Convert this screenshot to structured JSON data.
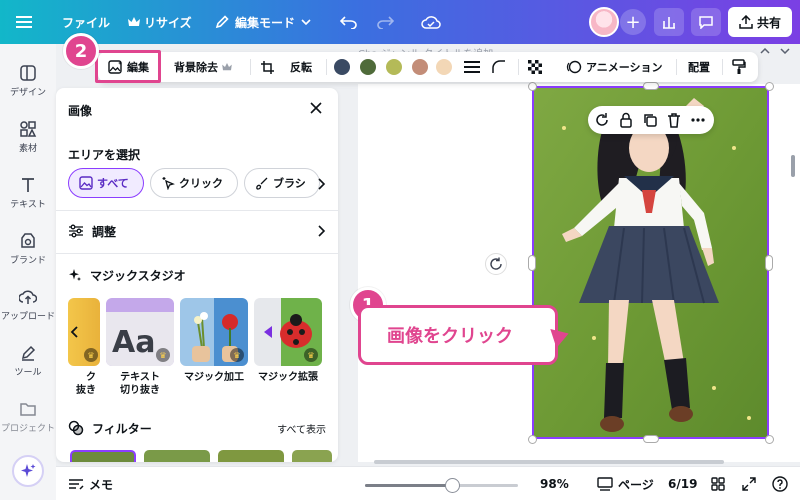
{
  "topbar": {
    "file_label": "ファイル",
    "resize_label": "リサイズ",
    "edit_mode_label": "編集モード",
    "share_label": "共有"
  },
  "ghost_title": "Cha ジャンル タイトルを追加",
  "rail": {
    "items": [
      {
        "label": "デザイン",
        "icon": "layout-icon"
      },
      {
        "label": "素材",
        "icon": "shapes-icon"
      },
      {
        "label": "テキスト",
        "icon": "text-icon"
      },
      {
        "label": "ブランド",
        "icon": "brand-icon"
      },
      {
        "label": "アップロード",
        "icon": "upload-icon"
      },
      {
        "label": "ツール",
        "icon": "pen-icon"
      },
      {
        "label": "プロジェクト",
        "icon": "folder-icon"
      }
    ]
  },
  "toolbar": {
    "edit_label": "編集",
    "bg_remove_label": "背景除去",
    "flip_label": "反転",
    "animation_label": "アニメーション",
    "position_label": "配置",
    "swatches": [
      "#3a4a63",
      "#4f6b3a",
      "#b4ba58",
      "#c38d78",
      "#f3d7b6"
    ]
  },
  "panel": {
    "title": "画像",
    "select_area_label": "エリアを選択",
    "chips": [
      "すべて",
      "クリック",
      "ブラシ"
    ],
    "adjust_label": "調整",
    "magic_studio_label": "マジックスタジオ",
    "tiles": [
      {
        "label": "ク\n抜き"
      },
      {
        "label": "テキスト\n切り抜き"
      },
      {
        "label": "マジック加工"
      },
      {
        "label": "マジック拡張"
      }
    ],
    "filter_label": "フィルター",
    "show_all_label": "すべて表示"
  },
  "annotations": {
    "step1": "1",
    "step2": "2",
    "callout_text": "画像をクリック"
  },
  "bottombar": {
    "memo_label": "メモ",
    "zoom_value": "98%",
    "zoom_fraction": 0.57,
    "page_label": "ページ",
    "page_count": "6/19"
  }
}
